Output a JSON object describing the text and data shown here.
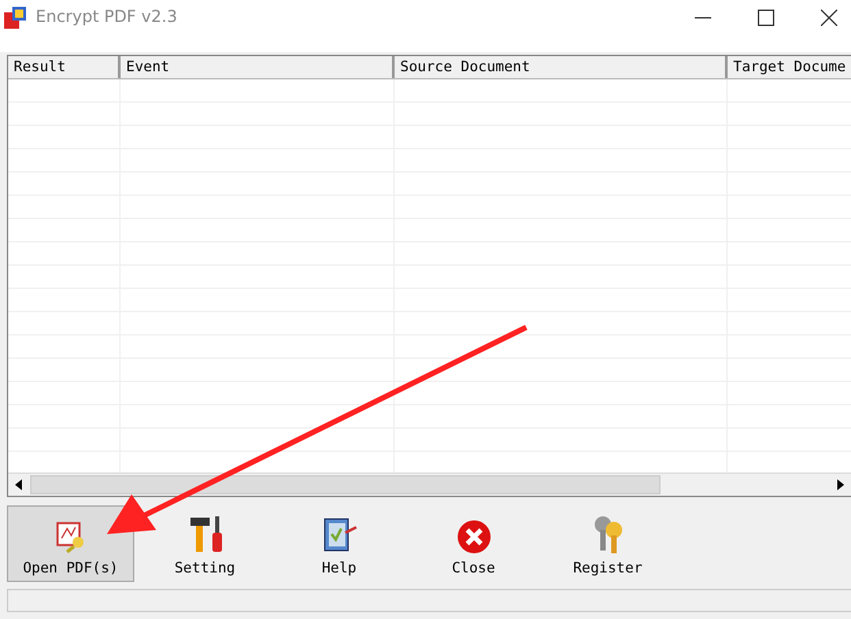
{
  "window": {
    "title": "Encrypt PDF v2.3"
  },
  "table": {
    "columns": [
      {
        "label": "Result"
      },
      {
        "label": "Event"
      },
      {
        "label": "Source Document"
      },
      {
        "label": "Target Docume"
      }
    ]
  },
  "toolbar": [
    {
      "label": "Open PDF(s)",
      "kind": "open",
      "selected": true
    },
    {
      "label": "Setting",
      "kind": "setting",
      "selected": false
    },
    {
      "label": "Help",
      "kind": "help",
      "selected": false
    },
    {
      "label": "Close",
      "kind": "close",
      "selected": false
    },
    {
      "label": "Register",
      "kind": "register",
      "selected": false
    }
  ]
}
